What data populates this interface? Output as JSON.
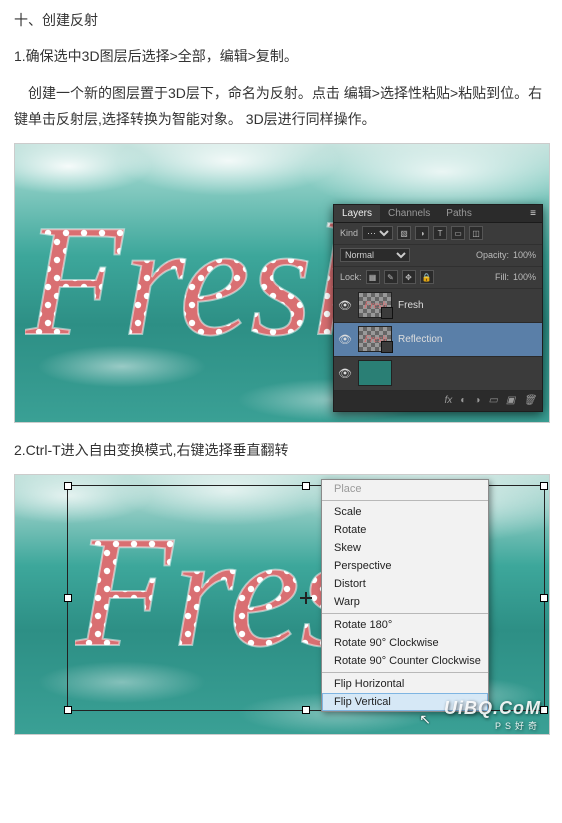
{
  "heading": "十、创建反射",
  "step1": "1.确保选中3D图层后选择>全部，编辑>复制。",
  "step1b": "创建一个新的图层置于3D层下，命名为反射。点击 编辑>选择性粘贴>粘贴到位。右键单击反射层,选择转换为智能对象。 3D层进行同样操作。",
  "step2": "2.Ctrl-T进入自由变换模式,右键选择垂直翻转",
  "layers_panel": {
    "tabs": [
      "Layers",
      "Channels",
      "Paths"
    ],
    "filter_label": "Kind",
    "blend_mode": "Normal",
    "opacity_label": "Opacity:",
    "opacity_value": "100%",
    "lock_label": "Lock:",
    "fill_label": "Fill:",
    "fill_value": "100%",
    "layers": [
      {
        "name": "Fresh",
        "visible": true,
        "smart_object": true
      },
      {
        "name": "Reflection",
        "visible": true,
        "smart_object": true,
        "active": true
      },
      {
        "name": "",
        "visible": true,
        "background": true
      }
    ],
    "footer_fx": "fx"
  },
  "context_menu": {
    "items": [
      {
        "label": "Place",
        "disabled": true
      },
      "-",
      {
        "label": "Scale"
      },
      {
        "label": "Rotate"
      },
      {
        "label": "Skew"
      },
      {
        "label": "Perspective"
      },
      {
        "label": "Distort"
      },
      {
        "label": "Warp"
      },
      "-",
      {
        "label": "Rotate 180°"
      },
      {
        "label": "Rotate 90° Clockwise"
      },
      {
        "label": "Rotate 90° Counter Clockwise"
      },
      "-",
      {
        "label": "Flip Horizontal"
      },
      {
        "label": "Flip Vertical",
        "hover": true
      }
    ]
  },
  "watermark": {
    "main": "UiBQ.CoM",
    "sub": "PS好奇"
  },
  "thumb_text": "Fresh",
  "chart_data": null
}
